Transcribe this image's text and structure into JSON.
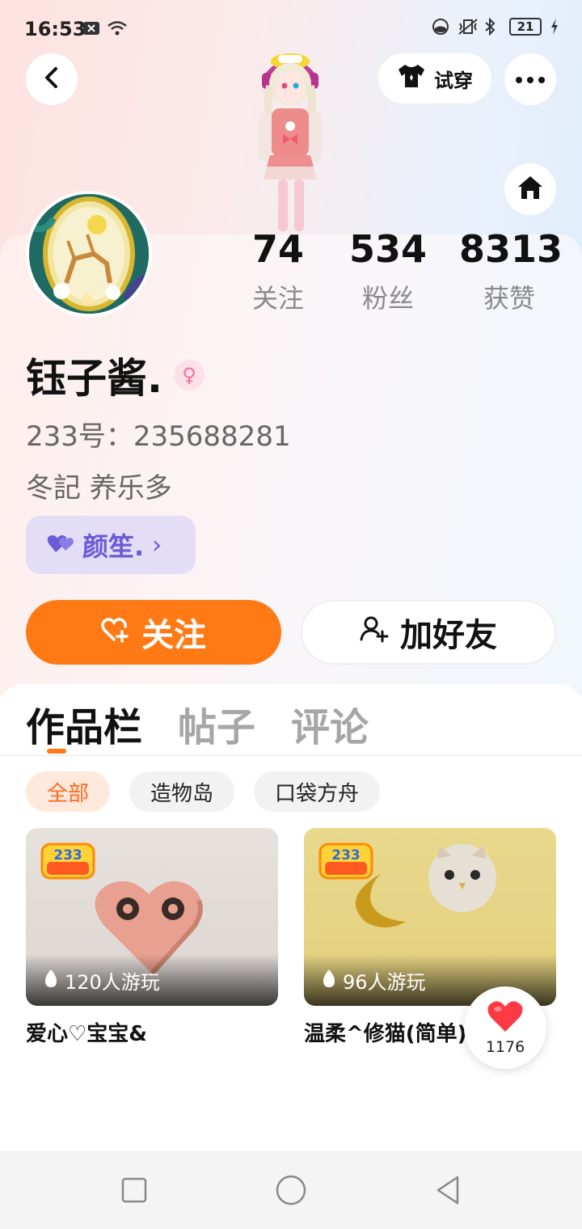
{
  "status_bar": {
    "time": "16:53",
    "battery": "21",
    "icons": [
      "close-notification-icon",
      "wifi-icon",
      "dnd-icon",
      "vibrate-icon",
      "bluetooth-icon",
      "battery-icon",
      "charging-icon"
    ]
  },
  "header": {
    "tryon_label": "试穿"
  },
  "stats": [
    {
      "value": "74",
      "label": "关注"
    },
    {
      "value": "534",
      "label": "粉丝"
    },
    {
      "value": "8313",
      "label": "获赞"
    }
  ],
  "profile": {
    "username": "钰子酱.",
    "gender_symbol": "♀",
    "uid": "233号：235688281",
    "bio": "冬記 养乐多",
    "cp_name": "颜笙.",
    "cp_arrow": "›"
  },
  "actions": {
    "follow_label": "关注",
    "add_friend_label": "加好友"
  },
  "tabs": [
    {
      "label": "作品栏",
      "active": true
    },
    {
      "label": "帖子",
      "active": false
    },
    {
      "label": "评论",
      "active": false
    }
  ],
  "filters": [
    {
      "label": "全部",
      "active": true
    },
    {
      "label": "造物岛",
      "active": false
    },
    {
      "label": "口袋方舟",
      "active": false
    }
  ],
  "works": [
    {
      "title": "爱心♡宝宝&",
      "plays": "120人游玩",
      "badge": "造物岛"
    },
    {
      "title": "温柔^修猫(简单)",
      "plays": "96人游玩",
      "badge": "造物岛"
    }
  ],
  "like_fab": {
    "count": "1176"
  },
  "colors": {
    "accent": "#ff7a14",
    "cp_tag_bg": "#e4ddf6",
    "cp_tag_text": "#6a5bd6"
  }
}
